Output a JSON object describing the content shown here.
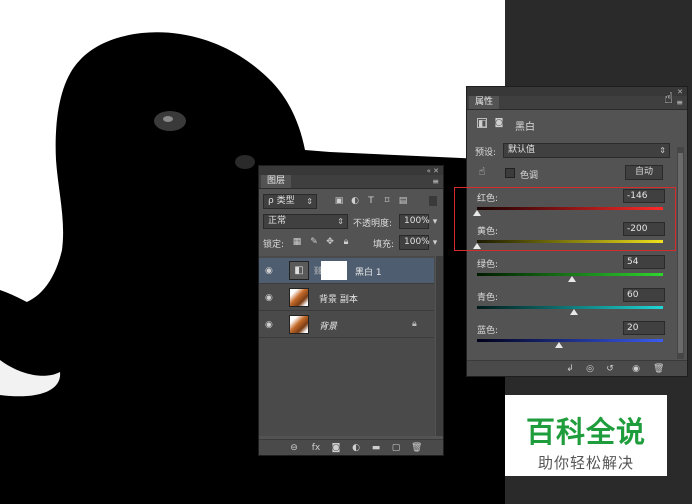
{
  "layers_panel": {
    "tab": "图层",
    "filter_label": "ρ 类型",
    "blend_mode": "正常",
    "opacity_label": "不透明度:",
    "opacity_value": "100%",
    "lock_label": "锁定:",
    "fill_label": "填充:",
    "fill_value": "100%",
    "layers": [
      {
        "name": "黑白 1",
        "selected": true
      },
      {
        "name": "背景 副本",
        "selected": false
      },
      {
        "name": "背景",
        "selected": false
      }
    ]
  },
  "properties_panel": {
    "tab": "属性",
    "adjustment_name": "黑白",
    "preset_label": "预设:",
    "preset_value": "默认值",
    "tint_label": "色调",
    "auto_button": "自动",
    "sliders": [
      {
        "label": "红色:",
        "value": "-146",
        "fraction": 0.0
      },
      {
        "label": "黄色:",
        "value": "-200",
        "fraction": 0.0
      },
      {
        "label": "绿色:",
        "value": "54",
        "fraction": 0.51
      },
      {
        "label": "青色:",
        "value": "60",
        "fraction": 0.52
      },
      {
        "label": "蓝色:",
        "value": "20",
        "fraction": 0.44
      }
    ]
  },
  "watermark": {
    "title": "百科全说",
    "subtitle": "助你轻松解决"
  },
  "colors": {
    "highlight": "#d62b2b",
    "watermark_green": "#1f9d3c",
    "selected_layer": "#4f5d70"
  }
}
